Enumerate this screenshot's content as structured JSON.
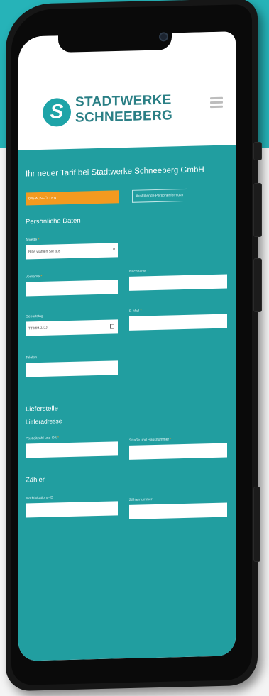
{
  "header": {
    "brand_line1": "STADTWERKE",
    "brand_line2": "SCHNEEBERG",
    "logo_letter": "S"
  },
  "main": {
    "heading": "Ihr neuer Tarif bei Stadtwerke Schneeberg GmbH",
    "progress_label": "0 % AUSFÜLLEN",
    "autofill_button": "Ausfüllende Personenformular"
  },
  "personal": {
    "section_title": "Persönliche Daten",
    "anrede_label": "Anrede",
    "anrede_value": "Bitte wählen Sie aus",
    "vorname_label": "Vorname",
    "nachname_label": "Nachname",
    "geburtstag_label": "Geburtstag",
    "geburtstag_value": "TT.MM.JJJJ",
    "email_label": "E-Mail",
    "telefon_label": "Telefon"
  },
  "delivery": {
    "section_title": "Lieferstelle",
    "subtitle": "Lieferadresse",
    "plz_label": "Postleitzahl und Ort",
    "street_label": "Straße und Hausnummer"
  },
  "meter": {
    "section_title": "Zähler",
    "location_label": "Marktlokations-ID",
    "number_label": "Zählernummer"
  },
  "colors": {
    "brand_teal": "#219ea0",
    "background_teal": "#26b3b8",
    "accent_orange": "#f39a1f"
  },
  "icons": [
    "menu-icon",
    "chevron-down-icon",
    "calendar-icon",
    "logo-icon",
    "camera-icon"
  ]
}
